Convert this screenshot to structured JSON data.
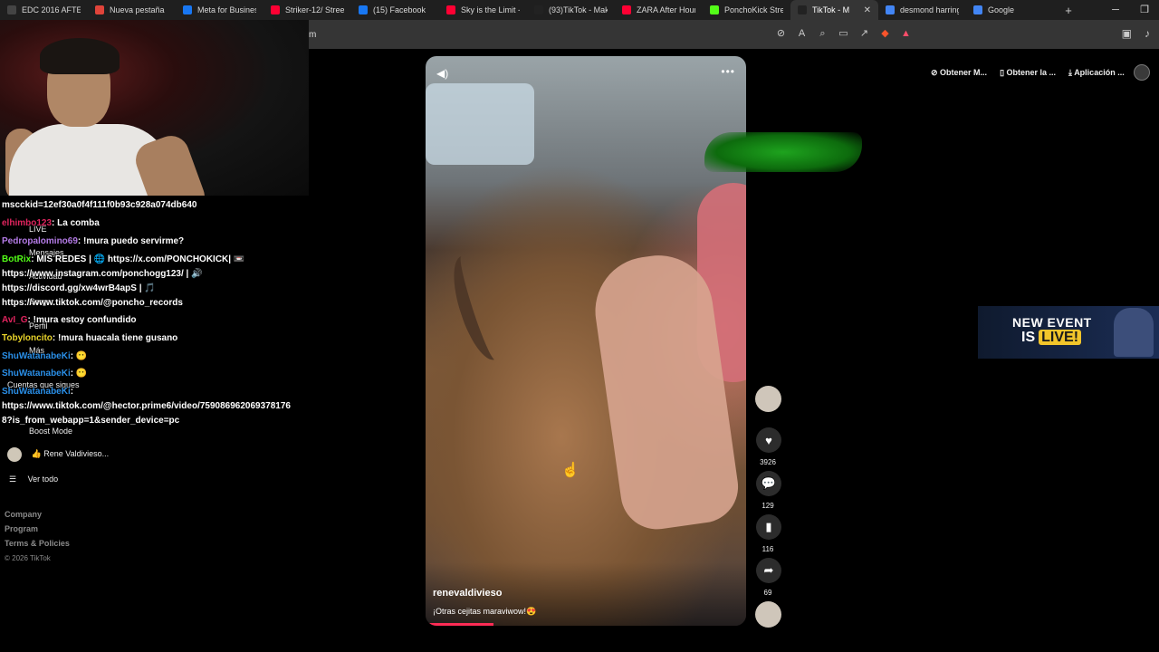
{
  "tabs": [
    {
      "title": "EDC 2016 AFTER",
      "icon": "app-icon",
      "color": "#444444"
    },
    {
      "title": "Nueva pestaña",
      "icon": "shield-icon",
      "color": "#e0443a"
    },
    {
      "title": "Meta for Busines",
      "icon": "meta-icon",
      "color": "#1877f2"
    },
    {
      "title": "Striker-12/ Street",
      "icon": "youtube-icon",
      "color": "#ff0033"
    },
    {
      "title": "(15) Facebook",
      "icon": "facebook-icon",
      "color": "#1877f2"
    },
    {
      "title": "Sky is the Limit -",
      "icon": "youtube-icon",
      "color": "#ff0033"
    },
    {
      "title": "(93)TikTok - Make",
      "icon": "tiktok-icon",
      "color": "#222222"
    },
    {
      "title": "ZARA After Hours",
      "icon": "youtube-icon",
      "color": "#ff0033"
    },
    {
      "title": "PonchoKick Strea",
      "icon": "kick-icon",
      "color": "#53fc18"
    },
    {
      "title": "TikTok - M",
      "icon": "tiktok-icon",
      "color": "#222222"
    },
    {
      "title": "desmond harring",
      "icon": "google-icon",
      "color": "#4285f4"
    },
    {
      "title": "Google",
      "icon": "google-icon",
      "color": "#4285f4"
    }
  ],
  "url": "m",
  "chat": [
    {
      "name": "",
      "name_color": "#ffffff",
      "msg": "mscckid=12ef30a0f4f111f0b93c928a074db640",
      "top": 0
    },
    {
      "name": "elhimbo123",
      "name_color": "#e0245e",
      "msg": ": La comba"
    },
    {
      "name": "Pedropalomino69",
      "name_color": "#b57ce8",
      "msg": ": !mura puedo servirme?"
    },
    {
      "name": "BotRix",
      "name_color": "#53fc18",
      "msg": ": MIS REDES | 🌐 https://x.com/PONCHOKICK| 📼"
    },
    {
      "name": "",
      "name_color": "#ffffff",
      "msg": "https://www.instagram.com/ponchogg123/ | 🔊"
    },
    {
      "name": "",
      "name_color": "#ffffff",
      "msg": "https://discord.gg/xw4wrB4apS | 🎵"
    },
    {
      "name": "",
      "name_color": "#ffffff",
      "msg": "https://www.tiktok.com/@poncho_records"
    },
    {
      "name": "AvI_G",
      "name_color": "#e0245e",
      "msg": ": !mura estoy confundido"
    },
    {
      "name": "Tobyloncito",
      "name_color": "#e8d32a",
      "msg": ": !mura huacala tiene gusano"
    },
    {
      "name": "ShuWatanabeKi",
      "name_color": "#2a8fe8",
      "msg": ": 😶"
    },
    {
      "name": "ShuWatanabeKi",
      "name_color": "#2a8fe8",
      "msg": ": 😶"
    },
    {
      "name": "ShuWatanabeKi",
      "name_color": "#2a8fe8",
      "msg": ":"
    },
    {
      "name": "",
      "name_color": "#ffffff",
      "msg": "https://www.tiktok.com/@hector.prime6/video/759086962069378176"
    },
    {
      "name": "",
      "name_color": "#ffffff",
      "msg": "8?is_from_webapp=1&sender_device=pc"
    }
  ],
  "sidebar": {
    "live": "LIVE",
    "mensajes": "Mensajes",
    "actividad": "Actividad",
    "subir": "Cargar",
    "perfil": "Perfil",
    "mas": "Más",
    "following_label": "Cuentas que sigues",
    "boost": "Boost Mode",
    "account": "👍 Rene Valdiviesо...",
    "see_all": "Ver todo",
    "footer": [
      "Company",
      "Program",
      "Terms & Policies",
      "© 2026 TikTok"
    ]
  },
  "video": {
    "username": "renevaldivieso",
    "caption": "¡Otras cejitas maraviwow!😍",
    "progress": 0.2
  },
  "actions": {
    "likes": "3926",
    "comments": "129",
    "saves": "116",
    "shares": "69"
  },
  "chips": [
    "Obtener M...",
    "Obtener la ...",
    "Aplicación ..."
  ],
  "event": {
    "line1": "NEW EVENT",
    "line2a": "IS",
    "line2b": "LIVE!"
  }
}
